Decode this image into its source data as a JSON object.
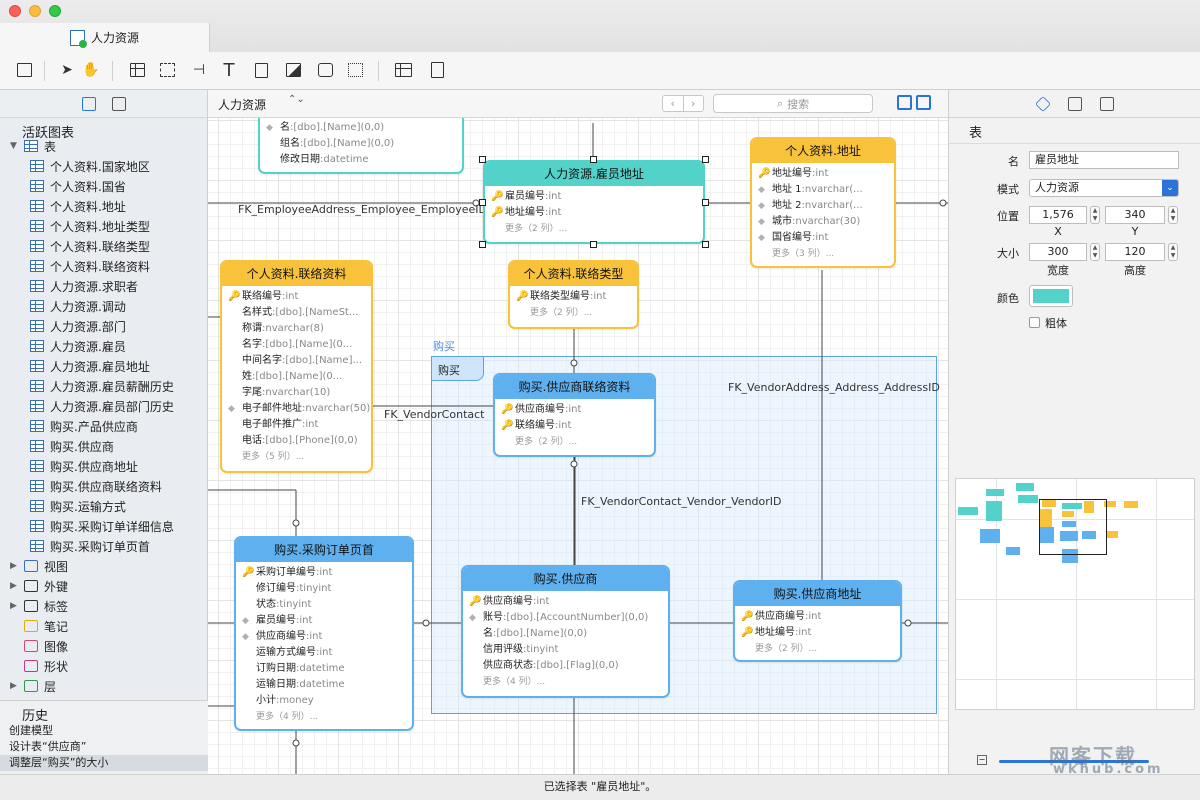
{
  "window": {
    "tab_title": "人力资源"
  },
  "colors": {
    "yellow": "#f8c23a",
    "blue": "#5eb0ef",
    "teal": "#52d2c8",
    "accent": "#2a74d8"
  },
  "left_panel": {
    "active_section": "活跃图表",
    "tables_node": "表",
    "tables": [
      "个人资料.国家地区",
      "个人资料.国省",
      "个人资料.地址",
      "个人资料.地址类型",
      "个人资料.联络类型",
      "个人资料.联络资料",
      "人力资源.求职者",
      "人力资源.调动",
      "人力资源.部门",
      "人力资源.雇员",
      "人力资源.雇员地址",
      "人力资源.雇员薪酬历史",
      "人力资源.雇员部门历史",
      "购买.产品供应商",
      "购买.供应商",
      "购买.供应商地址",
      "购买.供应商联络资料",
      "购买.运输方式",
      "购买.采购订单详细信息",
      "购买.采购订单页首"
    ],
    "other_nodes": [
      "视图",
      "外键",
      "标签",
      "笔记",
      "图像",
      "形状",
      "层"
    ],
    "history_title": "历史",
    "history": [
      "创建模型",
      "设计表“供应商”",
      "调整层“购买”的大小"
    ]
  },
  "canvas_header": {
    "model": "人力资源",
    "search_placeholder": "搜索"
  },
  "layer": {
    "name": "购买",
    "label": "购买"
  },
  "fk_labels": [
    "FK_EmployeeAddress_Employee_EmployeeID",
    "FK_VendorContact",
    "FK_VendorAddress_Address_AddressID",
    "FK_VendorContact_Vendor_VendorID"
  ],
  "entities": {
    "top_partial": {
      "fields": [
        {
          "name": "名",
          "type": ":[dbo].[Name](0,0)"
        },
        {
          "name": "组名",
          "type": ":[dbo].[Name](0,0)"
        },
        {
          "name": "修改日期",
          "type": ":datetime"
        }
      ]
    },
    "emp_address": {
      "title": "人力资源.雇员地址",
      "fields": [
        {
          "name": "雇员编号",
          "type": ":int"
        },
        {
          "name": "地址编号",
          "type": ":int"
        }
      ],
      "more": "更多（2 列）..."
    },
    "address": {
      "title": "个人资料.地址",
      "fields": [
        {
          "name": "地址编号",
          "type": ":int"
        },
        {
          "name": "地址 1",
          "type": ":nvarchar(..."
        },
        {
          "name": "地址 2",
          "type": ":nvarchar(..."
        },
        {
          "name": "城市",
          "type": ":nvarchar(30)"
        },
        {
          "name": "国省编号",
          "type": ":int"
        }
      ],
      "more": "更多（3 列）..."
    },
    "contact": {
      "title": "个人资料.联络资料",
      "fields": [
        {
          "name": "联络编号",
          "type": ":int"
        },
        {
          "name": "名样式",
          "type": ":[dbo].[NameSt..."
        },
        {
          "name": "称谓",
          "type": ":nvarchar(8)"
        },
        {
          "name": "名字",
          "type": ":[dbo].[Name](0..."
        },
        {
          "name": "中间名字",
          "type": ":[dbo].[Name]..."
        },
        {
          "name": "姓",
          "type": ":[dbo].[Name](0..."
        },
        {
          "name": "字尾",
          "type": ":nvarchar(10)"
        },
        {
          "name": "电子邮件地址",
          "type": ":nvarchar(50)"
        },
        {
          "name": "电子邮件推广",
          "type": ":int"
        },
        {
          "name": "电话",
          "type": ":[dbo].[Phone](0,0)"
        }
      ],
      "more": "更多（5 列）..."
    },
    "contact_type": {
      "title": "个人资料.联络类型",
      "fields": [
        {
          "name": "联络类型编号",
          "type": ":int"
        }
      ],
      "more": "更多（2 列）..."
    },
    "vendor_contact": {
      "title": "购买.供应商联络资料",
      "fields": [
        {
          "name": "供应商编号",
          "type": ":int"
        },
        {
          "name": "联络编号",
          "type": ":int"
        }
      ],
      "more": "更多（2 列）..."
    },
    "po_header": {
      "title": "购买.采购订单页首",
      "fields": [
        {
          "name": "采购订单编号",
          "type": ":int"
        },
        {
          "name": "修订编号",
          "type": ":tinyint"
        },
        {
          "name": "状态",
          "type": ":tinyint"
        },
        {
          "name": "雇员编号",
          "type": ":int"
        },
        {
          "name": "供应商编号",
          "type": ":int"
        },
        {
          "name": "运输方式编号",
          "type": ":int"
        },
        {
          "name": "订购日期",
          "type": ":datetime"
        },
        {
          "name": "运输日期",
          "type": ":datetime"
        },
        {
          "name": "小计",
          "type": ":money"
        }
      ],
      "more": "更多（4 列）..."
    },
    "vendor": {
      "title": "购买.供应商",
      "fields": [
        {
          "name": "供应商编号",
          "type": ":int"
        },
        {
          "name": "账号",
          "type": ":[dbo].[AccountNumber](0,0)"
        },
        {
          "name": "名",
          "type": ":[dbo].[Name](0,0)"
        },
        {
          "name": "信用评级",
          "type": ":tinyint"
        },
        {
          "name": "供应商状态",
          "type": ":[dbo].[Flag](0,0)"
        }
      ],
      "more": "更多（4 列）..."
    },
    "vendor_address": {
      "title": "购买.供应商地址",
      "fields": [
        {
          "name": "供应商编号",
          "type": ":int"
        },
        {
          "name": "地址编号",
          "type": ":int"
        }
      ],
      "more": "更多（2 列）..."
    }
  },
  "right_panel": {
    "title": "表",
    "name_label": "名",
    "name_value": "雇员地址",
    "schema_label": "模式",
    "schema_value": "人力资源",
    "position_label": "位置",
    "pos_x": "1,576",
    "pos_y": "340",
    "x_label": "X",
    "y_label": "Y",
    "size_label": "大小",
    "width": "300",
    "height": "120",
    "width_label": "宽度",
    "height_label": "高度",
    "color_label": "颜色",
    "color_value": "#52d2c8",
    "bold_label": "粗体"
  },
  "watermark": {
    "text": "网客下载",
    "url": "wkhub.com"
  },
  "status": "已选择表 \"雇员地址\"。"
}
